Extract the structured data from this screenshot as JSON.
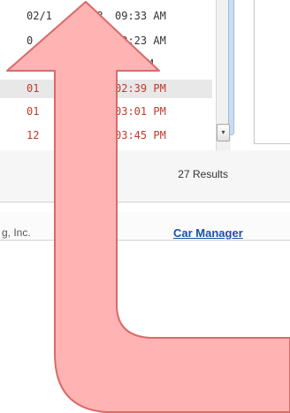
{
  "list": {
    "rows": [
      {
        "date": "02/1      13",
        "time": "09:33 AM",
        "color": "#333333",
        "selected": false
      },
      {
        "date": "0",
        "time": "09:23 AM",
        "color": "#333333",
        "selected": false
      },
      {
        "date": "",
        "time": ":18 PM",
        "color": "#333333",
        "selected": false
      },
      {
        "date": "01",
        "time": "02:39 PM",
        "color": "#c0392b",
        "selected": true
      },
      {
        "date": "01",
        "time": "03:01 PM",
        "color": "#c0392b",
        "selected": false
      },
      {
        "date": "12",
        "time": "03:45 PM",
        "color": "#c0392b",
        "selected": false
      }
    ],
    "scroll_down_glyph": "▾"
  },
  "results": {
    "label": "27 Results"
  },
  "footer": {
    "copyright": "g, Inc.",
    "product_link": "Car Manager"
  },
  "overlay": {
    "arrow_fill": "#ffb3b3",
    "arrow_stroke": "#d96a6a"
  }
}
